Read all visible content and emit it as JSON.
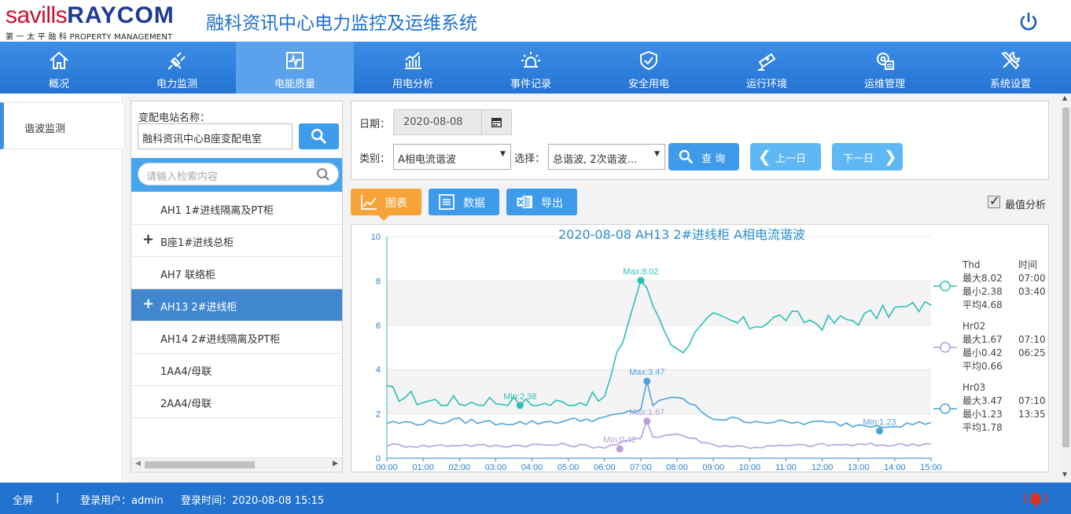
{
  "header": {
    "logo_main": "savills",
    "logo_brand": "RAYCOM",
    "logo_sub": "第 一 太 平 融 科 PROPERTY MANAGEMENT",
    "title": "融科资讯中心电力监控及运维系统"
  },
  "nav": [
    {
      "label": "概况",
      "icon": "home-icon"
    },
    {
      "label": "电力监测",
      "icon": "plug-icon"
    },
    {
      "label": "电能质量",
      "icon": "waveform-icon",
      "active": true
    },
    {
      "label": "用电分析",
      "icon": "bar-chart-icon"
    },
    {
      "label": "事件记录",
      "icon": "alarm-light-icon"
    },
    {
      "label": "安全用电",
      "icon": "shield-check-icon"
    },
    {
      "label": "运行环境",
      "icon": "camera-icon"
    },
    {
      "label": "运维管理",
      "icon": "gear-doc-icon"
    },
    {
      "label": "系统设置",
      "icon": "tools-icon"
    }
  ],
  "sidebar": {
    "items": [
      {
        "label": "谐波监测"
      }
    ]
  },
  "station": {
    "label": "变配电站名称：",
    "value": "融科资讯中心B座变配电室",
    "search_placeholder": "请输入检索内容"
  },
  "tree": [
    {
      "label": "AH1 1#进线隔离及PT柜",
      "expandable": false
    },
    {
      "label": "B座1#进线总柜",
      "expandable": true
    },
    {
      "label": "AH7 联络柜",
      "expandable": false
    },
    {
      "label": "AH13 2#进线柜",
      "expandable": true,
      "selected": true
    },
    {
      "label": "AH14 2#进线隔离及PT柜",
      "expandable": false
    },
    {
      "label": "1AA4/母联",
      "expandable": false
    },
    {
      "label": "2AA4/母联",
      "expandable": false
    }
  ],
  "filters": {
    "date_label": "日期：",
    "date_value": "2020-08-08",
    "type_label": "类别：",
    "type_value": "A相电流谐波",
    "select_label": "选择：",
    "select_value": "总谐波, 2次谐波…",
    "query_label": "查 询",
    "prev_label": "上一日",
    "next_label": "下一日"
  },
  "tabs": {
    "chart": "图表",
    "data": "数据",
    "export": "导出"
  },
  "peak_analysis": {
    "label": "最值分析",
    "checked": true
  },
  "colors": {
    "thd": "#2cbfb6",
    "hr02": "#b79ee0",
    "hr03": "#4aa3df",
    "accent": "#3d9be9",
    "nav": "#2f80dc",
    "active_tab": "#f7a33a"
  },
  "chart_data": {
    "type": "line",
    "title": "2020-08-08  AH13 2#进线柜  A相电流谐波",
    "x": [
      "00:00",
      "01:00",
      "02:00",
      "03:00",
      "04:00",
      "05:00",
      "06:00",
      "07:00",
      "08:00",
      "09:00",
      "10:00",
      "11:00",
      "12:00",
      "13:00",
      "14:00",
      "15:00"
    ],
    "ylim": [
      0,
      10
    ],
    "yticks": [
      0,
      2,
      4,
      6,
      8,
      10
    ],
    "grid": true,
    "legend_position": "right",
    "legend_header_time": "时间",
    "series": [
      {
        "name": "Thd",
        "color": "#2cbfb6",
        "values": [
          3.0,
          2.6,
          2.5,
          2.6,
          2.4,
          2.5,
          2.7,
          8.02,
          4.8,
          6.3,
          6.0,
          6.4,
          6.1,
          6.3,
          6.7,
          6.9
        ],
        "stats": [
          {
            "label": "最大8.02",
            "time": "07:00"
          },
          {
            "label": "最小2.38",
            "time": "03:40"
          },
          {
            "label": "平均4.68",
            "time": ""
          }
        ],
        "max": {
          "label": "Max:8.02",
          "x": 7.0,
          "y": 8.02
        },
        "min": {
          "label": "Min:2.38",
          "x": 3.67,
          "y": 2.38
        }
      },
      {
        "name": "Hr02",
        "color": "#b79ee0",
        "values": [
          0.6,
          0.55,
          0.6,
          0.55,
          0.6,
          0.6,
          0.5,
          0.9,
          1.1,
          0.6,
          0.5,
          0.55,
          0.6,
          0.6,
          0.6,
          0.65
        ],
        "stats": [
          {
            "label": "最大1.67",
            "time": "07:10"
          },
          {
            "label": "最小0.42",
            "time": "06:25"
          },
          {
            "label": "平均0.66",
            "time": ""
          }
        ],
        "max": {
          "label": "Max:1.67",
          "x": 7.17,
          "y": 1.67
        },
        "min": {
          "label": "Min:0.42",
          "x": 6.42,
          "y": 0.42
        }
      },
      {
        "name": "Hr03",
        "color": "#4aa3df",
        "values": [
          1.6,
          1.6,
          1.7,
          1.6,
          1.6,
          1.7,
          1.8,
          2.2,
          2.8,
          1.8,
          1.7,
          1.6,
          1.6,
          1.5,
          1.5,
          1.6
        ],
        "stats": [
          {
            "label": "最大3.47",
            "time": "07:10"
          },
          {
            "label": "最小1.23",
            "time": "13:35"
          },
          {
            "label": "平均1.78",
            "time": ""
          }
        ],
        "max": {
          "label": "Max:3.47",
          "x": 7.17,
          "y": 3.47
        },
        "min": {
          "label": "Min:1.23",
          "x": 13.58,
          "y": 1.23
        }
      }
    ]
  },
  "footer": {
    "fullscreen": "全屏",
    "separator": "|",
    "user": "登录用户：admin",
    "login_time": "登录时间：2020-08-08 15:15"
  }
}
